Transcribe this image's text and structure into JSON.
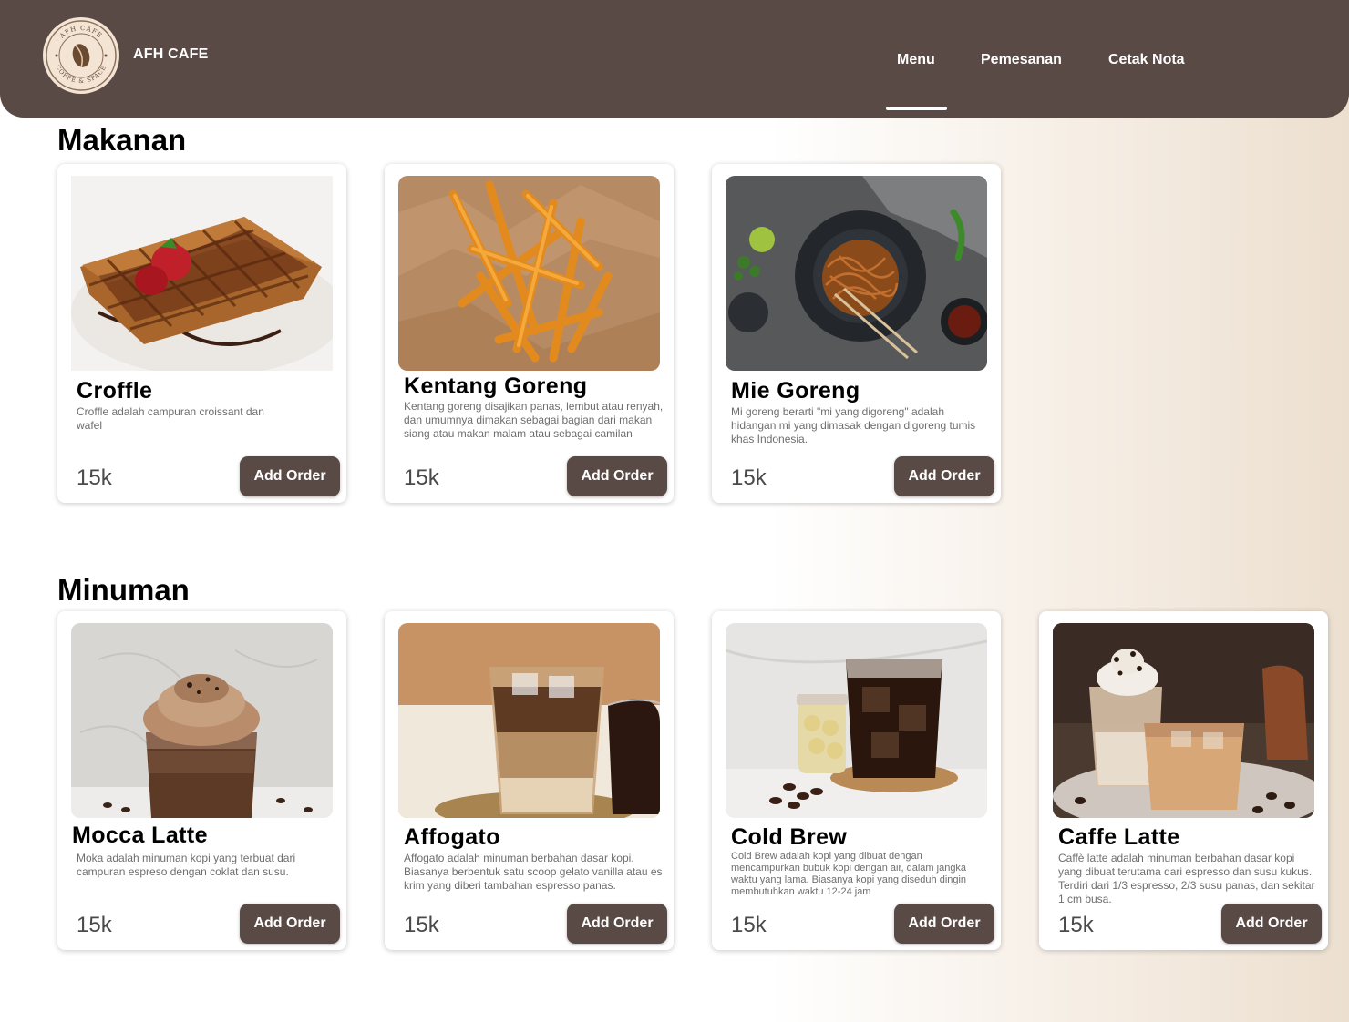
{
  "brand": {
    "name": "AFH CAFE",
    "logo_text_top": "AFH CAFE",
    "logo_text_bottom": "COFFE & SPACE"
  },
  "nav": {
    "items": [
      "Menu",
      "Pemesanan",
      "Cetak Nota"
    ],
    "active": "Menu"
  },
  "colors": {
    "primary": "#5a4a46",
    "accent_bg": "#ecdfcf"
  },
  "sections": {
    "makanan": {
      "title": "Makanan",
      "items": [
        {
          "name": "Croffle",
          "desc": "Croffle adalah campuran croissant dan wafel",
          "price": "15k",
          "button": "Add Order"
        },
        {
          "name": "Kentang Goreng",
          "desc": "Kentang goreng disajikan panas, lembut atau renyah, dan umumnya dimakan sebagai bagian dari makan siang atau makan malam atau sebagai camilan",
          "price": "15k",
          "button": "Add Order"
        },
        {
          "name": "Mie Goreng",
          "desc": "Mi goreng berarti \"mi yang digoreng\" adalah hidangan mi yang dimasak dengan digoreng tumis khas Indonesia.",
          "price": "15k",
          "button": "Add Order"
        }
      ]
    },
    "minuman": {
      "title": "Minuman",
      "items": [
        {
          "name": "Mocca Latte",
          "desc": "Moka adalah minuman kopi yang terbuat dari campuran espreso dengan coklat dan susu.",
          "price": "15k",
          "button": "Add Order"
        },
        {
          "name": "Affogato",
          "desc": "Affogato adalah minuman berbahan dasar kopi. Biasanya berbentuk satu scoop gelato vanilla atau es krim yang diberi tambahan espresso panas.",
          "price": "15k",
          "button": "Add Order"
        },
        {
          "name": "Cold Brew",
          "desc": "Cold Brew adalah kopi yang dibuat dengan mencampurkan bubuk kopi dengan air, dalam jangka waktu yang lama. Biasanya kopi yang diseduh dingin membutuhkan waktu 12-24 jam",
          "price": "15k",
          "button": "Add Order"
        },
        {
          "name": "Caffe Latte",
          "desc": "Caffè latte adalah minuman berbahan dasar kopi yang dibuat terutama dari espresso dan susu kukus. Terdiri dari 1/3 espresso, 2/3 susu panas, dan sekitar 1 cm busa.",
          "price": "15k",
          "button": "Add Order"
        }
      ]
    }
  }
}
